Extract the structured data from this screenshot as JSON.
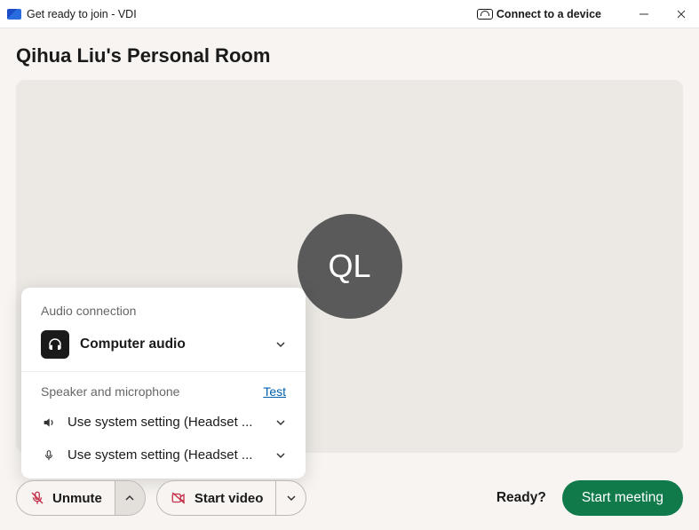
{
  "window": {
    "title": "Get ready to join - VDI",
    "connect_device": "Connect to a device"
  },
  "page": {
    "title": "Qihua Liu's Personal Room",
    "avatar_initials": "QL"
  },
  "audio_popup": {
    "heading": "Audio connection",
    "type_label": "Computer audio",
    "section_label": "Speaker and microphone",
    "test_link": "Test",
    "speaker_label": "Use system setting (Headset ...",
    "mic_label": "Use system setting (Headset ..."
  },
  "controls": {
    "unmute": "Unmute",
    "start_video": "Start video",
    "ready": "Ready?",
    "start_meeting": "Start meeting"
  }
}
